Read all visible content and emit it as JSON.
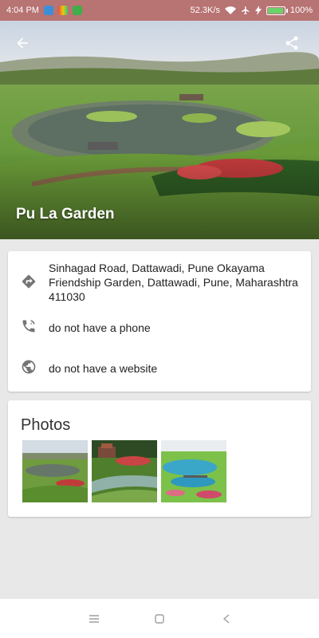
{
  "status_bar": {
    "time": "4:04 PM",
    "net_speed": "52.3K/s",
    "battery_text": "100%",
    "battery_level": 1.0
  },
  "header": {
    "back_icon": "arrow-back-icon",
    "share_icon": "share-icon",
    "place_name": "Pu La Garden"
  },
  "info": {
    "address": "Sinhagad Road, Dattawadi, Pune Okayama Friendship Garden, Dattawadi, Pune, Maharashtra 411030",
    "phone": "do not have a phone",
    "website": "do not have a website"
  },
  "photos": {
    "title": "Photos",
    "count": 3
  },
  "colors": {
    "status_bar": "#b87373",
    "icon_gray": "#757575"
  }
}
